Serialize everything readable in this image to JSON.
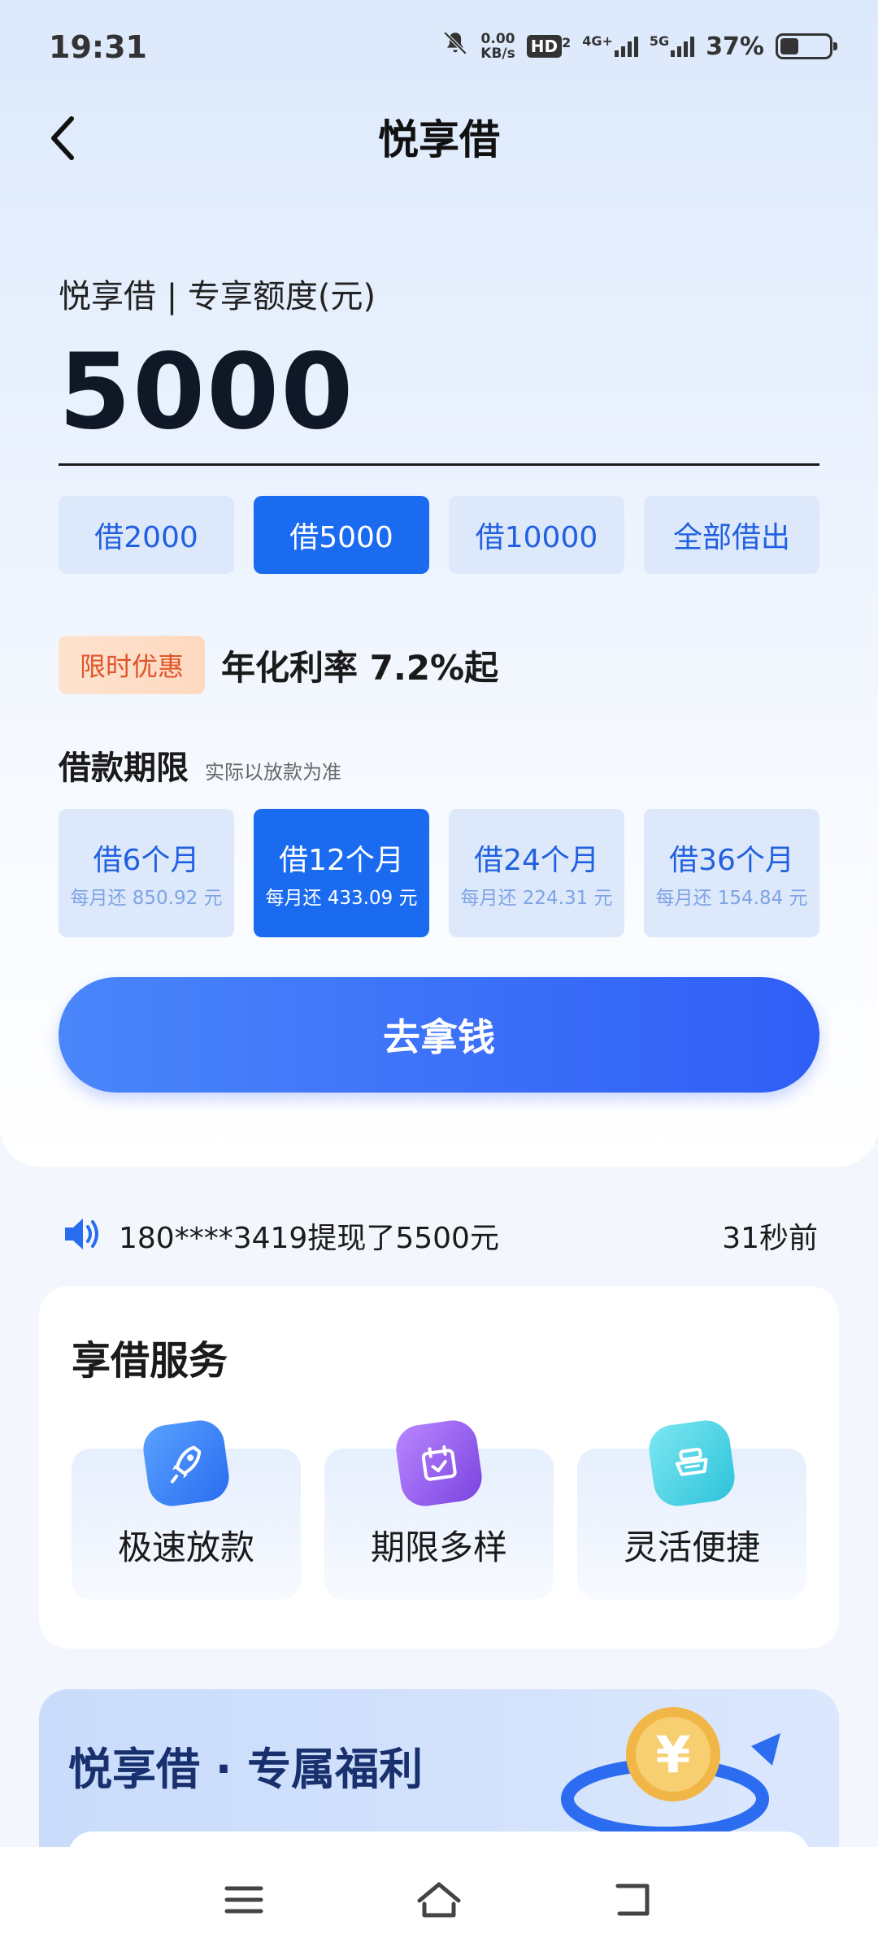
{
  "status_bar": {
    "time": "19:31",
    "net_speed_value": "0.00",
    "net_speed_unit": "KB/s",
    "hd_label": "HD",
    "hd_sub": "2",
    "sig1_label": "4G+",
    "sig2_label": "5G",
    "battery": "37%",
    "battery_level": 0.37
  },
  "header": {
    "title": "悦享借"
  },
  "quota": {
    "label": "悦享借 | 专享额度(元)",
    "amount": "5000"
  },
  "amount_options": [
    {
      "label": "借2000",
      "selected": false
    },
    {
      "label": "借5000",
      "selected": true
    },
    {
      "label": "借10000",
      "selected": false
    },
    {
      "label": "全部借出",
      "selected": false
    }
  ],
  "promo": {
    "badge": "限时优惠",
    "text": "年化利率 7.2%起"
  },
  "term": {
    "title": "借款期限",
    "note": "实际以放款为准",
    "options": [
      {
        "label": "借6个月",
        "sub": "每月还 850.92 元",
        "selected": false
      },
      {
        "label": "借12个月",
        "sub": "每月还 433.09 元",
        "selected": true
      },
      {
        "label": "借24个月",
        "sub": "每月还 224.31 元",
        "selected": false
      },
      {
        "label": "借36个月",
        "sub": "每月还 154.84 元",
        "selected": false
      }
    ]
  },
  "cta": {
    "label": "去拿钱"
  },
  "ticker": {
    "text": "180****3419提现了5500元",
    "time": "31秒前"
  },
  "services": {
    "title": "享借服务",
    "items": [
      {
        "label": "极速放款",
        "icon": "rocket-icon"
      },
      {
        "label": "期限多样",
        "icon": "calendar-icon"
      },
      {
        "label": "灵活便捷",
        "icon": "stack-icon"
      }
    ]
  },
  "benefits": {
    "title": "悦享借 · 专属福利"
  },
  "colors": {
    "primary": "#1a6bf0",
    "primary_light": "#dde9fb",
    "promo_text": "#e0552a",
    "benefits_title": "#18306d"
  }
}
